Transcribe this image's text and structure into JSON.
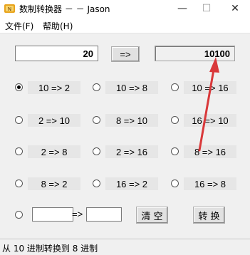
{
  "window": {
    "title": "数制转换器 － － Jason",
    "minimize_glyph": "—",
    "maximize_glyph": "☐",
    "close_glyph": "✕"
  },
  "menu": {
    "file": "文件(F)",
    "help": "帮助(H)"
  },
  "converter": {
    "input_value": "20",
    "convert_button": "=>",
    "output_value": "10100"
  },
  "options": [
    {
      "label": "10 => 2",
      "checked": true
    },
    {
      "label": "10 => 8",
      "checked": false
    },
    {
      "label": "10 => 16",
      "checked": false
    },
    {
      "label": "2 => 10",
      "checked": false
    },
    {
      "label": "8 => 10",
      "checked": false
    },
    {
      "label": "16 => 10",
      "checked": false
    },
    {
      "label": "2 => 8",
      "checked": false
    },
    {
      "label": "2 => 16",
      "checked": false
    },
    {
      "label": "8 => 16",
      "checked": false
    },
    {
      "label": "8 => 2",
      "checked": false
    },
    {
      "label": "16 => 2",
      "checked": false
    },
    {
      "label": "16 => 8",
      "checked": false
    }
  ],
  "custom": {
    "from_value": "",
    "arrow": "=>",
    "to_value": "",
    "clear_button": "清 空",
    "convert_button": "转 换"
  },
  "status": {
    "text": "从 10 进制转换到 8 进制"
  },
  "annotation": {
    "color": "#d9383a",
    "icon": "red-arrow-icon"
  }
}
